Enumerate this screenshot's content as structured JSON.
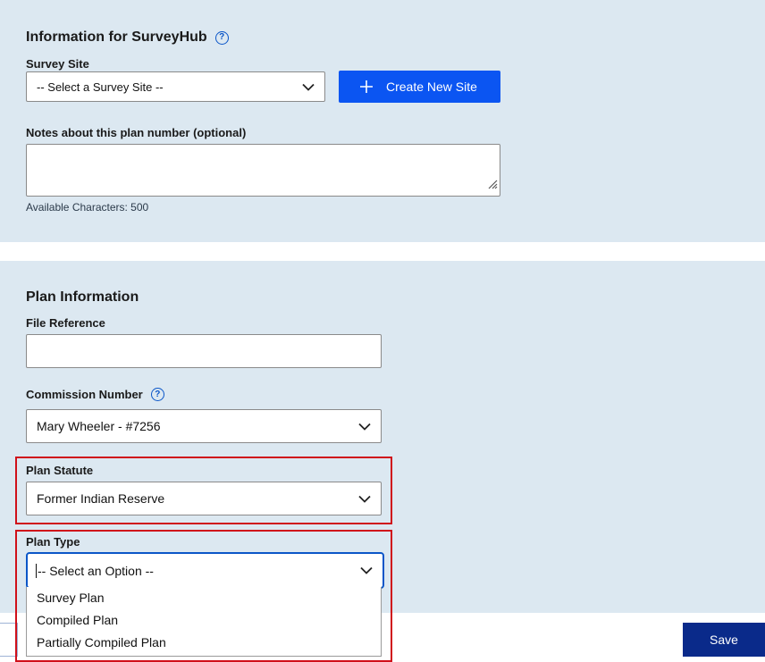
{
  "surveyhub": {
    "heading": "Information for SurveyHub",
    "survey_site_label": "Survey Site",
    "survey_site_value": "-- Select a Survey Site --",
    "create_site_label": "Create New Site",
    "notes_label": "Notes about this plan number (optional)",
    "notes_value": "",
    "available_chars": "Available Characters: 500"
  },
  "plan": {
    "heading": "Plan Information",
    "file_reference_label": "File Reference",
    "file_reference_value": "",
    "commission_label": "Commission Number",
    "commission_value": "Mary Wheeler - #7256",
    "statute_label": "Plan Statute",
    "statute_value": "Former Indian Reserve",
    "type_label": "Plan Type",
    "type_value": "-- Select an Option --",
    "type_options": [
      "Survey Plan",
      "Compiled Plan",
      "Partially Compiled Plan"
    ]
  },
  "footer": {
    "save_label": "Save"
  },
  "colors": {
    "panel_bg": "#dce8f1",
    "primary_blue": "#0b55f2",
    "save_navy": "#0a2a8a",
    "highlight_red": "#d0101a",
    "help_blue": "#0b56c8"
  },
  "icons": {
    "help": "question-circle-icon",
    "chevron": "chevron-down-icon",
    "plus": "plus-icon",
    "resize": "resize-grip-icon"
  }
}
